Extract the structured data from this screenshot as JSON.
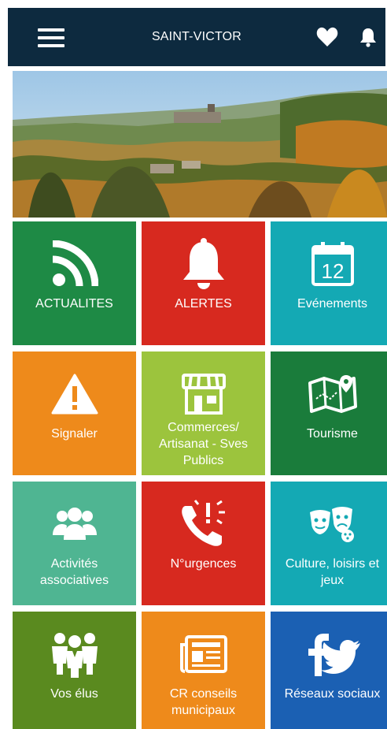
{
  "header": {
    "title": "SAINT-VICTOR"
  },
  "tiles": [
    {
      "label": "ACTUALITES",
      "color": "#1e8a45"
    },
    {
      "label": "ALERTES",
      "color": "#d7291f"
    },
    {
      "label": "Evénements",
      "color": "#14a9b4",
      "calendar_day": "12"
    },
    {
      "label": "Signaler",
      "color": "#ee8a1b"
    },
    {
      "label": "Commerces/ Artisanat - Sves Publics",
      "color": "#9cc43d"
    },
    {
      "label": "Tourisme",
      "color": "#1a7c3b"
    },
    {
      "label": "Activités associatives",
      "color": "#4fb592"
    },
    {
      "label": "N°urgences",
      "color": "#d7291f"
    },
    {
      "label": "Culture, loisirs et jeux",
      "color": "#14a9b4"
    },
    {
      "label": "Vos élus",
      "color": "#5a8a1f"
    },
    {
      "label": "CR conseils municipaux",
      "color": "#ee8a1b"
    },
    {
      "label": "Réseaux sociaux",
      "color": "#1b60b3"
    }
  ]
}
